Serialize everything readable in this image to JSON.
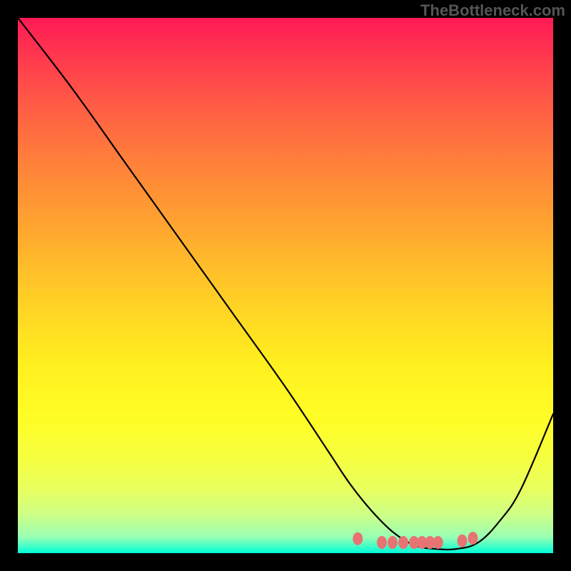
{
  "watermark": "TheBottleneck.com",
  "chart_data": {
    "type": "line",
    "title": "",
    "xlabel": "",
    "ylabel": "",
    "xlim": [
      0,
      100
    ],
    "ylim": [
      0,
      100
    ],
    "series": [
      {
        "name": "curve",
        "x": [
          0,
          10,
          20,
          30,
          40,
          50,
          58,
          62,
          66,
          70,
          74,
          78,
          82,
          86,
          90,
          94,
          100
        ],
        "values": [
          100,
          87,
          73,
          59,
          45,
          31,
          19,
          13,
          8,
          4,
          1.5,
          0.8,
          0.8,
          2,
          6,
          12,
          26
        ]
      }
    ],
    "markers": {
      "name": "dots",
      "color": "#e77373",
      "x": [
        63.5,
        68,
        70,
        72,
        74,
        75.5,
        77,
        78.5,
        83,
        85
      ],
      "values": [
        2.7,
        2,
        2,
        2,
        2,
        2,
        2,
        2,
        2.3,
        2.8
      ]
    },
    "gradient_colors": {
      "top": "#ff1a55",
      "mid": "#ffd624",
      "bottom": "#00ffd9"
    }
  }
}
